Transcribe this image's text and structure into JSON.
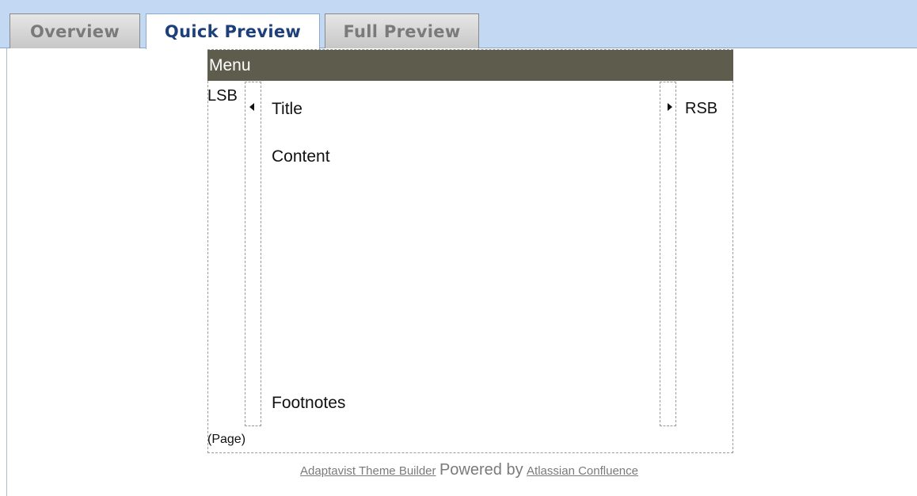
{
  "tabs": [
    {
      "label": "Overview",
      "active": false
    },
    {
      "label": "Quick Preview",
      "active": true
    },
    {
      "label": "Full Preview",
      "active": false
    }
  ],
  "layout": {
    "menu": "Menu",
    "lsb": "LSB",
    "rsb": "RSB",
    "title": "Title",
    "content": "Content",
    "footnotes": "Footnotes",
    "page": "(Page)"
  },
  "footer": {
    "link1": "Adaptavist Theme Builder",
    "powered": "Powered by",
    "link2": "Atlassian Confluence"
  },
  "colors": {
    "tabbar_bg": "#c3d8f3",
    "menu_bg": "#5e5d4d",
    "active_tab_text": "#1d3f7a"
  }
}
